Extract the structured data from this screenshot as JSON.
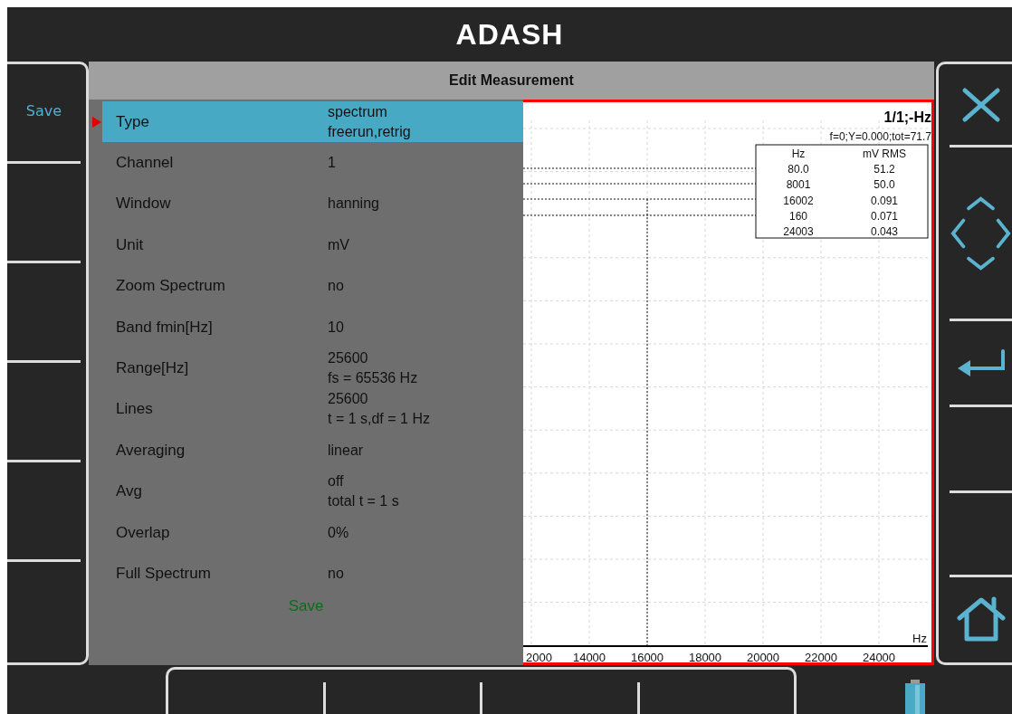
{
  "header": {
    "title": "ADASH"
  },
  "left_softkeys": [
    {
      "label": "Save"
    }
  ],
  "dialog": {
    "title": "Edit Measurement",
    "rows": [
      {
        "label": "Type",
        "values": [
          "spectrum",
          "freerun,retrig"
        ],
        "selected": true
      },
      {
        "label": "Channel",
        "values": [
          "1"
        ],
        "selected": false
      },
      {
        "label": "Window",
        "values": [
          "hanning"
        ],
        "selected": false
      },
      {
        "label": "Unit",
        "values": [
          "mV"
        ],
        "selected": false
      },
      {
        "label": "Zoom Spectrum",
        "values": [
          "no"
        ],
        "selected": false
      },
      {
        "label": "Band fmin[Hz]",
        "values": [
          "10"
        ],
        "selected": false
      },
      {
        "label": "Range[Hz]",
        "values": [
          "25600",
          "fs = 65536 Hz"
        ],
        "selected": false
      },
      {
        "label": "Lines",
        "values": [
          "25600",
          "t = 1 s,df = 1 Hz"
        ],
        "selected": false
      },
      {
        "label": "Averaging",
        "values": [
          "linear"
        ],
        "selected": false
      },
      {
        "label": "Avg",
        "values": [
          "off",
          "total t = 1 s"
        ],
        "selected": false
      },
      {
        "label": "Overlap",
        "values": [
          "0%"
        ],
        "selected": false
      },
      {
        "label": "Full Spectrum",
        "values": [
          "no"
        ],
        "selected": false
      }
    ],
    "save_label": "Save"
  },
  "chart": {
    "title": "1/1;-Hz",
    "subtitle": "f=0;Y=0.000;tot=71.7",
    "x_unit": "Hz",
    "x_tick_labels": [
      "2000",
      "14000",
      "16000",
      "18000",
      "20000",
      "22000",
      "24000"
    ],
    "peak_table": {
      "columns": [
        "Hz",
        "mV RMS"
      ],
      "rows": [
        [
          "80.0",
          "51.2"
        ],
        [
          "8001",
          "50.0"
        ],
        [
          "16002",
          "0.091"
        ],
        [
          "160",
          "0.071"
        ],
        [
          "24003",
          "0.043"
        ]
      ]
    }
  }
}
